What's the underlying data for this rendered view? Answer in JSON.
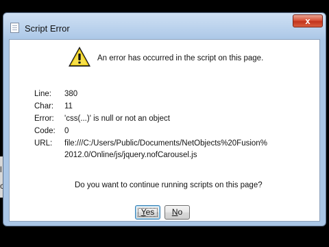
{
  "window": {
    "title": "Script Error",
    "close_label": "x"
  },
  "message": "An error has occurred in the script on this page.",
  "details": [
    {
      "label": "Line:",
      "value": "380"
    },
    {
      "label": "Char:",
      "value": "11"
    },
    {
      "label": "Error:",
      "value": "'css(...)' is null or not an object"
    },
    {
      "label": "Code:",
      "value": "0"
    },
    {
      "label": "URL:",
      "value": "file:///C:/Users/Public/Documents/NetObjects%20Fusion%",
      "value2": "2012.0/Online/js/jquery.nofCarousel.js"
    }
  ],
  "question": "Do you want to continue running scripts on this page?",
  "buttons": {
    "yes": {
      "accel": "Y",
      "rest": "es"
    },
    "no": {
      "accel": "N",
      "rest": "o"
    }
  },
  "background": {
    "letter1": "l",
    "letter2": "c"
  },
  "icons": {
    "title": "script-page-icon",
    "warning": "warning-triangle-icon"
  }
}
